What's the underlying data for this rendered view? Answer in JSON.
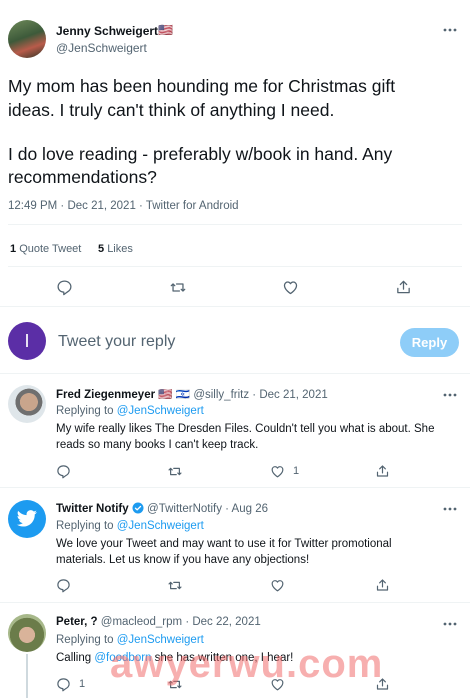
{
  "main_tweet": {
    "author_name": "Jenny Schweigert",
    "author_flag": "🇺🇸",
    "author_handle": "@JenSchweigert",
    "body_line1": "My mom has been hounding me for Christmas gift",
    "body_line2": "ideas. I truly can't think of anything I need.",
    "body_line3": "I do love reading - preferably w/book in hand. Any",
    "body_line4": "recommendations?",
    "timestamp": "12:49 PM · Dec 21, 2021 · Twitter for Android",
    "quote_count": "1",
    "quote_label": "Quote Tweet",
    "like_count": "5",
    "like_label": "Likes"
  },
  "compose": {
    "avatar_letter": "I",
    "placeholder": "Tweet your reply",
    "reply_button": "Reply"
  },
  "replies": [
    {
      "author_name": "Fred Ziegenmeyer",
      "author_flags": "🇺🇸 🇮🇱",
      "author_handle": "@silly_fritz",
      "date": "· Dec 21, 2021",
      "replying_prefix": "Replying to",
      "replying_to": "@JenSchweigert",
      "text_line1": "My wife really likes The Dresden Files. Couldn't tell you what is about. She",
      "text_line2": "reads so many books I can't keep track.",
      "like_count": "1"
    },
    {
      "author_name": "Twitter Notify",
      "author_handle": "@TwitterNotify",
      "date": "· Aug 26",
      "replying_prefix": "Replying to",
      "replying_to": "@JenSchweigert",
      "text_line1": "We love your Tweet and may want to use it for Twitter promotional",
      "text_line2": "materials. Let us know if you have any objections!"
    },
    {
      "author_name": "Peter, ?",
      "author_handle": "@macleod_rpm",
      "date": "· Dec 22, 2021",
      "replying_prefix": "Replying to",
      "replying_to": "@JenSchweigert",
      "text_prefix": "Calling",
      "text_mention": "@foodborn",
      "text_suffix": "she has written one, I hear!",
      "reply_count": "1"
    }
  ],
  "watermark": "awyerwu.com",
  "colors": {
    "accent": "#1d9bf0",
    "reply_button_disabled": "#8ecdf8",
    "compose_avatar": "#5b2ea6"
  }
}
